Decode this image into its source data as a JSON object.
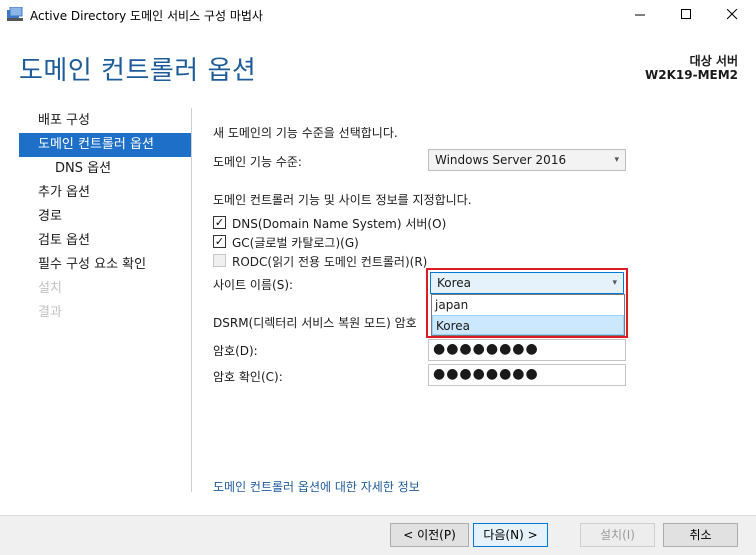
{
  "window": {
    "title": "Active Directory 도메인 서비스 구성 마법사",
    "app_icon": "ad-wizard-icon",
    "controls": [
      "minimize",
      "maximize",
      "close"
    ]
  },
  "header": {
    "page_title": "도메인 컨트롤러 옵션",
    "target_label": "대상 서버",
    "target_server": "W2K19-MEM2"
  },
  "nav": {
    "items": [
      {
        "label": "배포 구성",
        "state": "normal"
      },
      {
        "label": "도메인 컨트롤러 옵션",
        "state": "active"
      },
      {
        "label": "DNS 옵션",
        "state": "sub"
      },
      {
        "label": "추가 옵션",
        "state": "normal"
      },
      {
        "label": "경로",
        "state": "normal"
      },
      {
        "label": "검토 옵션",
        "state": "normal"
      },
      {
        "label": "필수 구성 요소 확인",
        "state": "normal"
      },
      {
        "label": "설치",
        "state": "disabled"
      },
      {
        "label": "결과",
        "state": "disabled"
      }
    ]
  },
  "main": {
    "section1_title": "새 도메인의 기능 수준을 선택합니다.",
    "domain_level_label": "도메인 기능 수준:",
    "domain_level_value": "Windows Server 2016",
    "section2_title": "도메인 컨트롤러 기능 및 사이트 정보를 지정합니다.",
    "checkboxes": [
      {
        "label": "DNS(Domain Name System) 서버(O)",
        "checked": true,
        "enabled": true
      },
      {
        "label": "GC(글로벌 카탈로그)(G)",
        "checked": true,
        "enabled": true
      },
      {
        "label": "RODC(읽기 전용 도메인 컨트롤러)(R)",
        "checked": false,
        "enabled": false
      }
    ],
    "site_name_label": "사이트 이름(S):",
    "site_name_value": "Korea",
    "site_options": [
      "japan",
      "Korea"
    ],
    "site_selected_option": "Korea",
    "dsrm_label": "DSRM(디렉터리 서비스 복원 모드) 암호",
    "password_label": "암호(D):",
    "password_value": "●●●●●●●●",
    "confirm_label": "암호 확인(C):",
    "confirm_value": "●●●●●●●●",
    "more_link": "도메인 컨트롤러 옵션에 대한 자세한 정보"
  },
  "footer": {
    "back_label": "< 이전(P)",
    "next_label": "다음(N) >",
    "install_label": "설치(I)",
    "cancel_label": "취소"
  },
  "colors": {
    "accent": "#1e6fc7",
    "title_blue": "#1e5b99",
    "highlight_frame": "#e01b24",
    "option_selected": "#cce8ff"
  }
}
